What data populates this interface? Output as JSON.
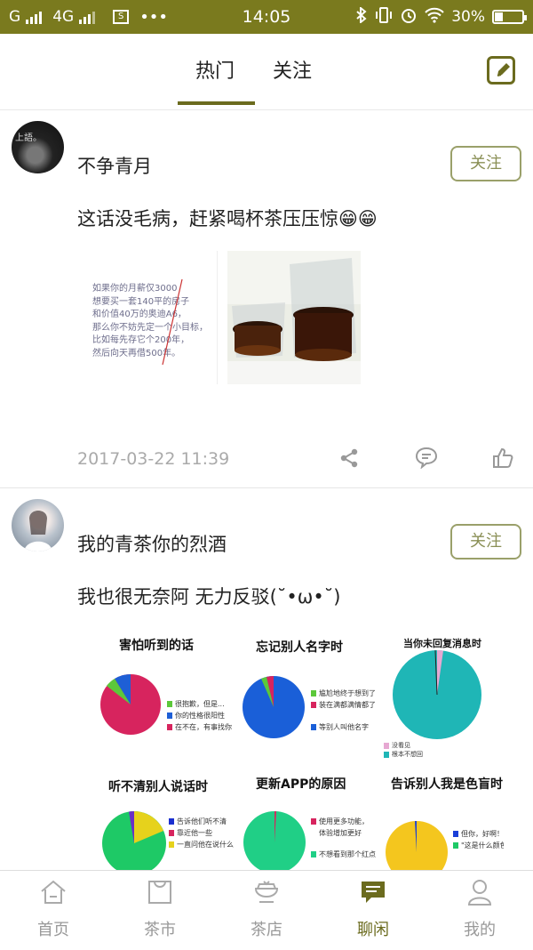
{
  "status_bar": {
    "carrier_1": "G",
    "network": "4G",
    "time": "14:05",
    "battery": "30%",
    "battery_level": 0.3,
    "icons": [
      "signal-icon",
      "sim-icon",
      "more-icon",
      "bluetooth-icon",
      "vibrate-icon",
      "alarm-icon",
      "wifi-icon",
      "battery-icon"
    ]
  },
  "top_nav": {
    "tabs": [
      {
        "label": "热门",
        "active": true
      },
      {
        "label": "关注",
        "active": false
      }
    ],
    "edit_icon": "edit-icon"
  },
  "posts": [
    {
      "username": "不争青月",
      "avatar_text": "上語。",
      "follow_label": "关注",
      "content": "这话没毛病，赶紧喝杯茶压压惊😁😁",
      "image_text": "如果你的月薪仅3000\n想要买一套140平的房子\n和价值40万的奥迪A6，\n那么你不妨先定一个小目标，\n比如每先存它个200年，\n然后向天再借500年。",
      "image_text_lines": [
        "如果你的月薪仅3000",
        "想要买一套140平的房子",
        "和价值40万的奥迪A6，",
        "那么你不妨先定一个小目标，",
        "比如每先存它个200年，",
        "然后向天再借500年。"
      ],
      "time": "2017-03-22 11:39",
      "actions": [
        "share-icon",
        "comment-icon",
        "like-icon"
      ]
    },
    {
      "username": "我的青茶你的烈酒",
      "follow_label": "关注",
      "content": "我也很无奈阿 无力反驳(˘•ω•˘)",
      "charts": [
        {
          "title": "害怕听到的话",
          "legend": [
            "很抱歉，但是...",
            "你的性格很阳性",
            "在不在，有事找你"
          ]
        },
        {
          "title": "忘记别人名字时",
          "legend": [
            "尴尬地终于想到了",
            "装在满都满情都了",
            "等别人叫他名字"
          ]
        },
        {
          "title": "当你未回复消息时",
          "legend": [
            "没看见",
            "根本不想回"
          ]
        },
        {
          "title": "听不清别人说话时",
          "legend": [
            "告诉他们听不清",
            "靠近他一些",
            "一直问他在说什么"
          ]
        },
        {
          "title": "更新APP的原因",
          "legend": [
            "使用更多功能，",
            "体验增加更好",
            "不想看到那个红点"
          ]
        },
        {
          "title": "告诉别人我是色盲时",
          "legend": [
            "但你，好啊！",
            "\"这是什么颜色？\""
          ]
        }
      ]
    }
  ],
  "bottom_nav": [
    {
      "label": "首页",
      "icon": "home-icon",
      "active": false
    },
    {
      "label": "茶市",
      "icon": "bag-icon",
      "active": false
    },
    {
      "label": "茶店",
      "icon": "shop-icon",
      "active": false
    },
    {
      "label": "聊闲",
      "icon": "chat-icon",
      "active": true
    },
    {
      "label": "我的",
      "icon": "user-icon",
      "active": false
    }
  ],
  "colors": {
    "status_bar": "#7a7a1e",
    "accent": "#6b6b1e",
    "follow_border": "#9aa06a",
    "muted_text": "#aaaaaa"
  }
}
